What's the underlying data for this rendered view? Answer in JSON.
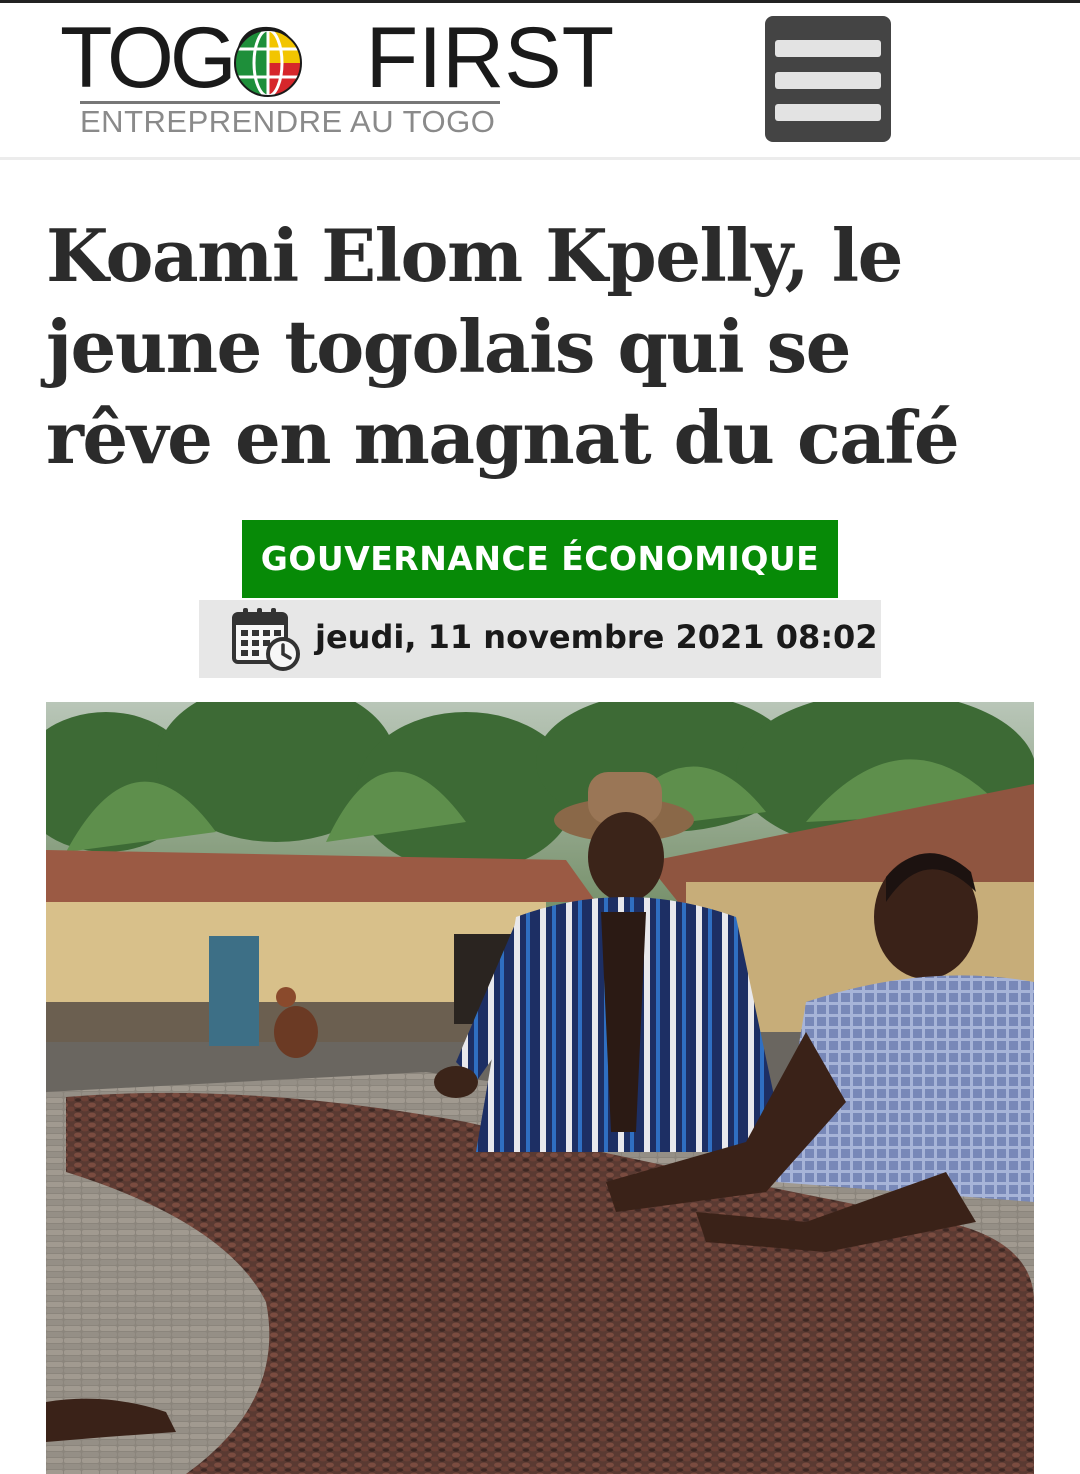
{
  "header": {
    "logo_main": "TOGO",
    "logo_first": "FIRST",
    "logo_tagline": "ENTREPRENDRE AU TOGO",
    "menu_icon": "hamburger-menu-icon"
  },
  "article": {
    "title": "Koami Elom Kpelly, le jeune togolais qui se rêve en magnat du café",
    "category": "GOUVERNANCE ÉCONOMIQUE",
    "date": "jeudi, 11 novembre 2021 08:02",
    "date_icon": "calendar-clock-icon",
    "image": "photo of two men spreading cocoa beans on a drying table"
  },
  "colors": {
    "category_bg": "#078a07",
    "menu_bg": "#444444",
    "title_text": "#2b2b2b",
    "date_bg": "#e7e7e7"
  }
}
